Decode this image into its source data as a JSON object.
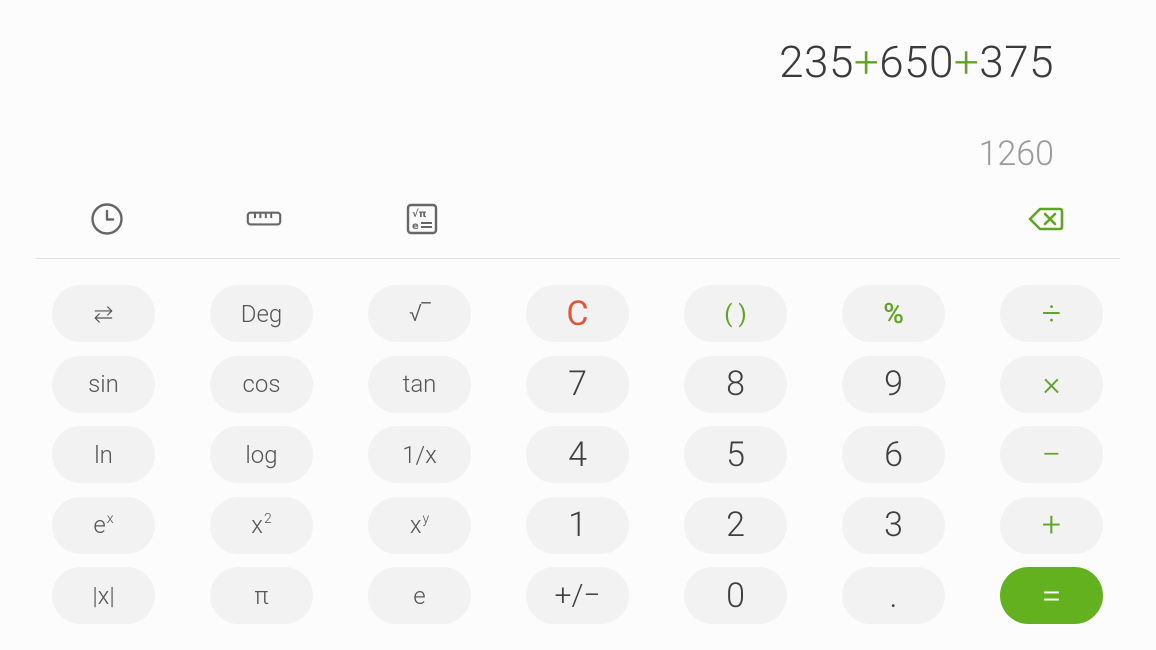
{
  "display": {
    "expression_parts": [
      {
        "text": "235",
        "type": "num"
      },
      {
        "text": "+",
        "type": "op"
      },
      {
        "text": "650",
        "type": "num"
      },
      {
        "text": "+",
        "type": "op"
      },
      {
        "text": "375",
        "type": "num"
      }
    ],
    "result": "1260"
  },
  "toolbar": {
    "history_icon": "clock-icon",
    "unit_converter_icon": "ruler-icon",
    "scientific_toggle_icon": "scientific-functions-icon",
    "backspace_icon": "backspace-icon"
  },
  "keypad": {
    "rows": [
      [
        "⇆",
        "Deg",
        "√‾",
        "C",
        "( )",
        "%",
        "÷"
      ],
      [
        "sin",
        "cos",
        "tan",
        "7",
        "8",
        "9",
        "×"
      ],
      [
        "ln",
        "log",
        "1/x",
        "4",
        "5",
        "6",
        "−"
      ],
      [
        "e^x",
        "x^2",
        "x^y",
        "1",
        "2",
        "3",
        "+"
      ],
      [
        "|x|",
        "π",
        "e",
        "+/−",
        "0",
        ".",
        "="
      ]
    ],
    "labels": {
      "swap": "⇆",
      "deg": "Deg",
      "sqrt": "√‾",
      "clear": "C",
      "parens": "( )",
      "percent": "%",
      "divide": "÷",
      "sin": "sin",
      "cos": "cos",
      "tan": "tan",
      "seven": "7",
      "eight": "8",
      "nine": "9",
      "multiply": "×",
      "ln": "ln",
      "log": "log",
      "reciprocal": "1/x",
      "four": "4",
      "five": "5",
      "six": "6",
      "minus": "−",
      "exp_base": "e",
      "exp_sup": "x",
      "square_base": "x",
      "square_sup": "2",
      "power_base": "x",
      "power_sup": "y",
      "one": "1",
      "two": "2",
      "three": "3",
      "plus": "+",
      "abs": "|x|",
      "pi": "π",
      "e": "e",
      "negate": "+/−",
      "zero": "0",
      "decimal": ".",
      "equals": "="
    }
  },
  "colors": {
    "accent": "#64b11f",
    "operator": "#5fa523",
    "clear": "#e0573c",
    "key_bg": "#f2f2f2",
    "background": "#fcfcfc"
  }
}
